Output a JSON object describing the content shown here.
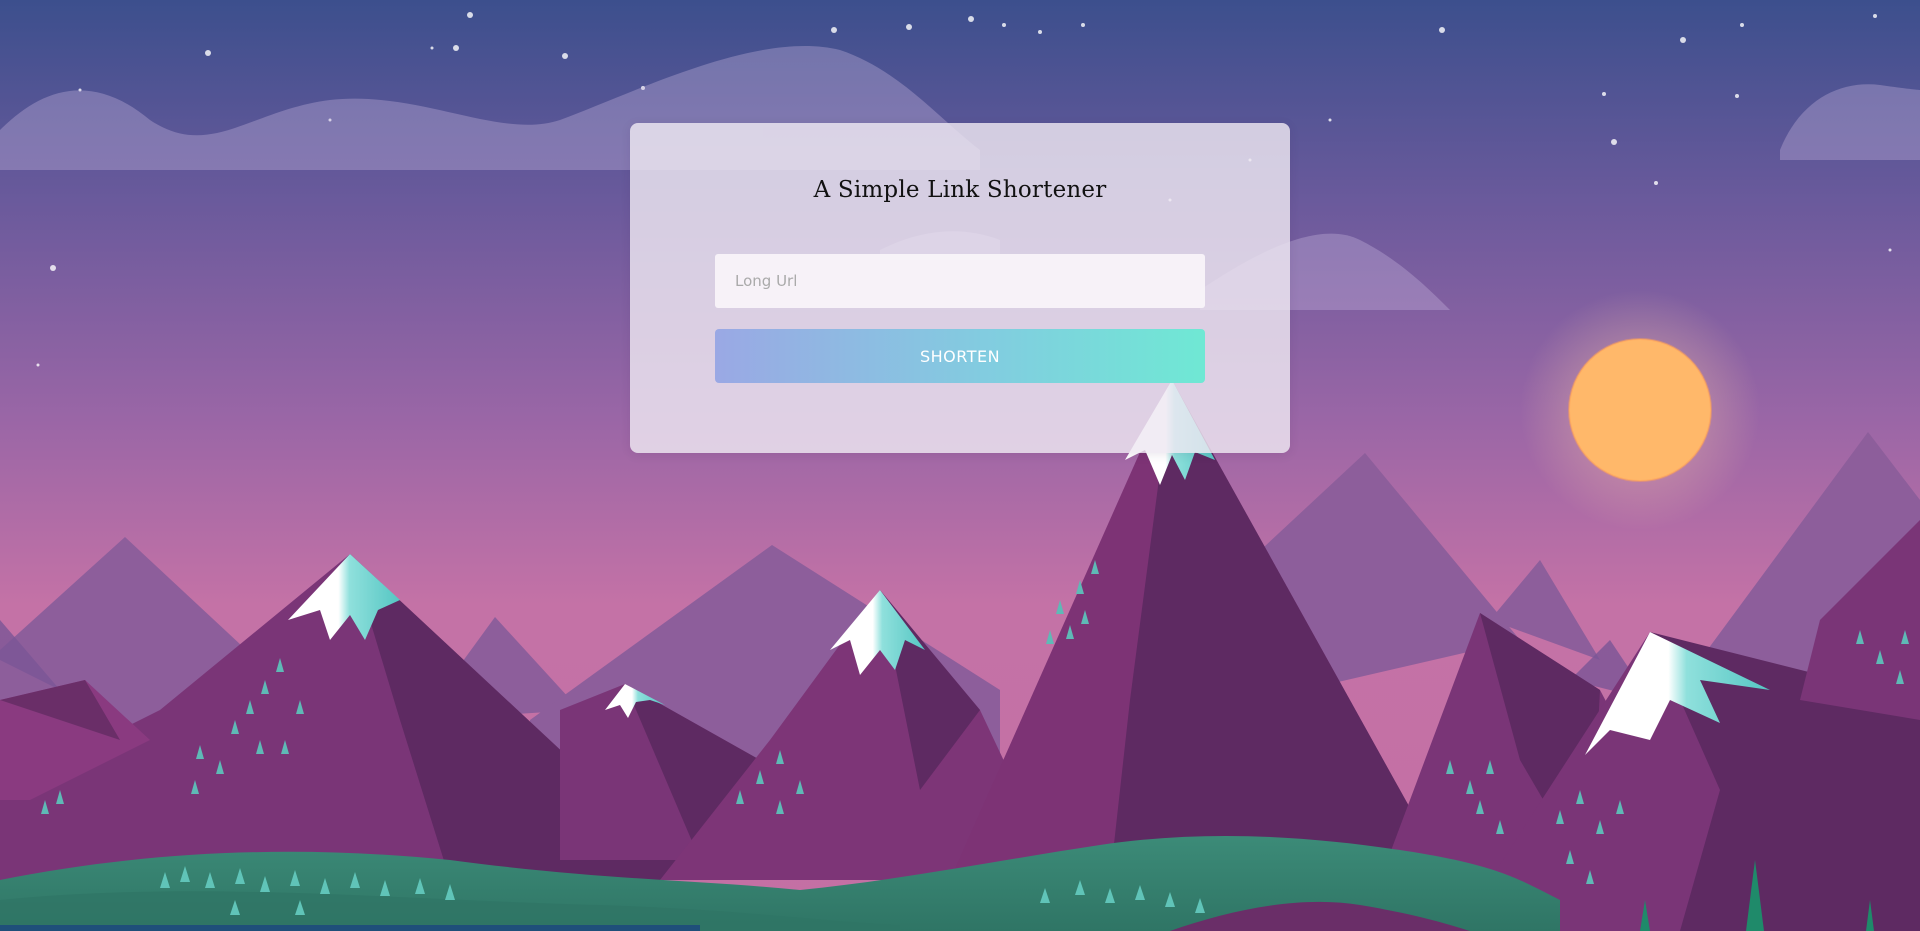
{
  "app": {
    "title": "A Simple Link Shortener"
  },
  "form": {
    "url_value": "",
    "url_placeholder": "Long Url",
    "submit_label": "SHORTEN"
  },
  "background": {
    "description_icon": "mountain-landscape-illustration",
    "colors": {
      "sky_top": "#3d4f8c",
      "sky_mid": "#8a62a0",
      "sky_bottom": "#c472a6",
      "sun": "#ffb468",
      "mountain_dark": "#5e2a62",
      "mountain_mid": "#7d3375",
      "mountain_far": "#8e5e9a",
      "snow": "#ffffff",
      "snow_shadow": "#6fd2cf",
      "hill": "#3f8a78",
      "tree": "#58bfb5"
    }
  }
}
